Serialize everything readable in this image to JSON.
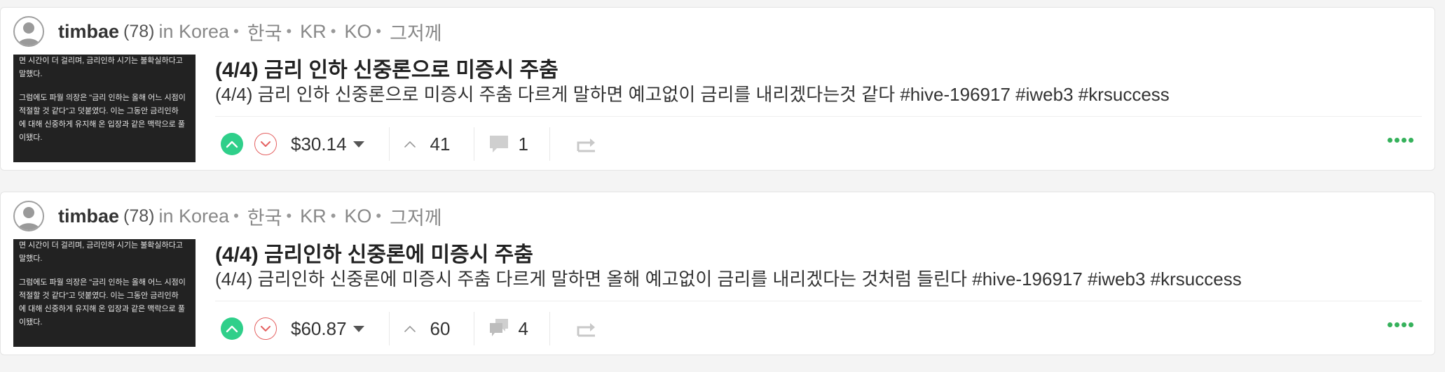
{
  "colors": {
    "upvote": "#2fcf8a",
    "downvote": "#e46060",
    "more_dots": "#35b15b",
    "thumbnail_bg": "#222222"
  },
  "posts": [
    {
      "author": "timbae",
      "reputation": "(78)",
      "community_prefix": "in Korea",
      "tags": [
        "한국",
        "KR",
        "KO",
        "그저께"
      ],
      "thumbnail_lines_1": [
        "면 시간이 더 걸리며, 금리인하 시기는 불확실하다고",
        "말했다."
      ],
      "thumbnail_lines_2": [
        "그럼에도 파월 의장은 \"금리 인하는 올해 어느 시점이",
        "적절할 것 같다\"고 덧붙였다. 이는 그동안 금리인하",
        "에 대해 신중하게 유지해 온 입장과 같은 맥락으로 풀",
        "이됐다."
      ],
      "title": "(4/4) 금리 인하 신중론으로 미증시 주춤",
      "summary": "(4/4) 금리 인하 신중론으로 미증시 주춤 다르게 말하면 예고없이 금리를 내리겠다는것 같다 #hive-196917 #iweb3 #krsuccess",
      "payout": "$30.14",
      "votes": "41",
      "comments": "1",
      "icons": [
        "avatar-icon",
        "upvote-icon",
        "downvote-icon",
        "caret-down-icon",
        "votes-chevron-icon",
        "comment-icon",
        "reblog-icon",
        "more-icon"
      ]
    },
    {
      "author": "timbae",
      "reputation": "(78)",
      "community_prefix": "in Korea",
      "tags": [
        "한국",
        "KR",
        "KO",
        "그저께"
      ],
      "thumbnail_lines_1": [
        "면 시간이 더 걸리며, 금리인하 시기는 불확실하다고",
        "말했다."
      ],
      "thumbnail_lines_2": [
        "그럼에도 파월 의장은 \"금리 인하는 올해 어느 시점이",
        "적절할 것 같다\"고 덧붙였다. 이는 그동안 금리인하",
        "에 대해 신중하게 유지해 온 입장과 같은 맥락으로 풀",
        "이됐다."
      ],
      "title": "(4/4) 금리인하 신중론에 미증시 주춤",
      "summary": "(4/4) 금리인하 신중론에 미증시 주춤 다르게 말하면 올해 예고없이 금리를 내리겠다는 것처럼 들린다 #hive-196917 #iweb3 #krsuccess",
      "payout": "$60.87",
      "votes": "60",
      "comments": "4",
      "icons": [
        "avatar-icon",
        "upvote-icon",
        "downvote-icon",
        "caret-down-icon",
        "votes-chevron-icon",
        "comments-icon",
        "reblog-icon",
        "more-icon"
      ]
    }
  ]
}
